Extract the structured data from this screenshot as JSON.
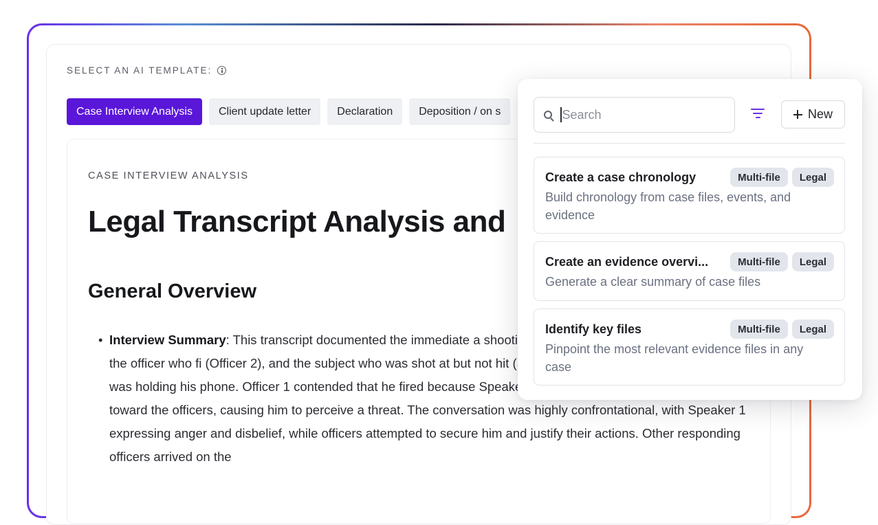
{
  "template_picker": {
    "label": "SELECT AN AI TEMPLATE:",
    "tabs": [
      {
        "label": "Case Interview Analysis"
      },
      {
        "label": "Client update letter"
      },
      {
        "label": "Declaration"
      },
      {
        "label": "Deposition / on s"
      }
    ]
  },
  "document": {
    "eyebrow": "CASE INTERVIEW ANALYSIS",
    "title": "Legal Transcript Analysis and",
    "section_heading": "General Overview",
    "bullet_lead": "Interview Summary",
    "bullet_text": ": This transcript documented the immediate a shooting. The primary interaction was between the officer who fi (Officer 2), and the subject who was shot at but not hit (Speaker shot at him for no reason while he was holding his phone. Officer 1 contended that he fired because Speaker 1 pointed the object at him and advanced toward the officers, causing him to perceive a threat. The conversation was highly confrontational, with Speaker 1 expressing anger and disbelief, while officers attempted to secure him and justify their actions. Other responding officers arrived on the"
  },
  "popover": {
    "search": {
      "placeholder": "Search",
      "value": ""
    },
    "new_label": "New",
    "templates": [
      {
        "title": "Create a case chronology",
        "description": "Build chronology from case files, events, and evidence",
        "badges": [
          "Multi-file",
          "Legal"
        ]
      },
      {
        "title": "Create an evidence overvi...",
        "description": "Generate a clear summary of case files",
        "badges": [
          "Multi-file",
          "Legal"
        ]
      },
      {
        "title": "Identify key files",
        "description": "Pinpoint the most relevant evidence files in any case",
        "badges": [
          "Multi-file",
          "Legal"
        ]
      }
    ]
  },
  "colors": {
    "accent": "#5a16d9",
    "filter_icon": "#6d2fe0",
    "frame_gradient": [
      "#6b2fe8",
      "#5b8fd6",
      "#2a2a4a",
      "#e9866a",
      "#e8693a"
    ]
  }
}
